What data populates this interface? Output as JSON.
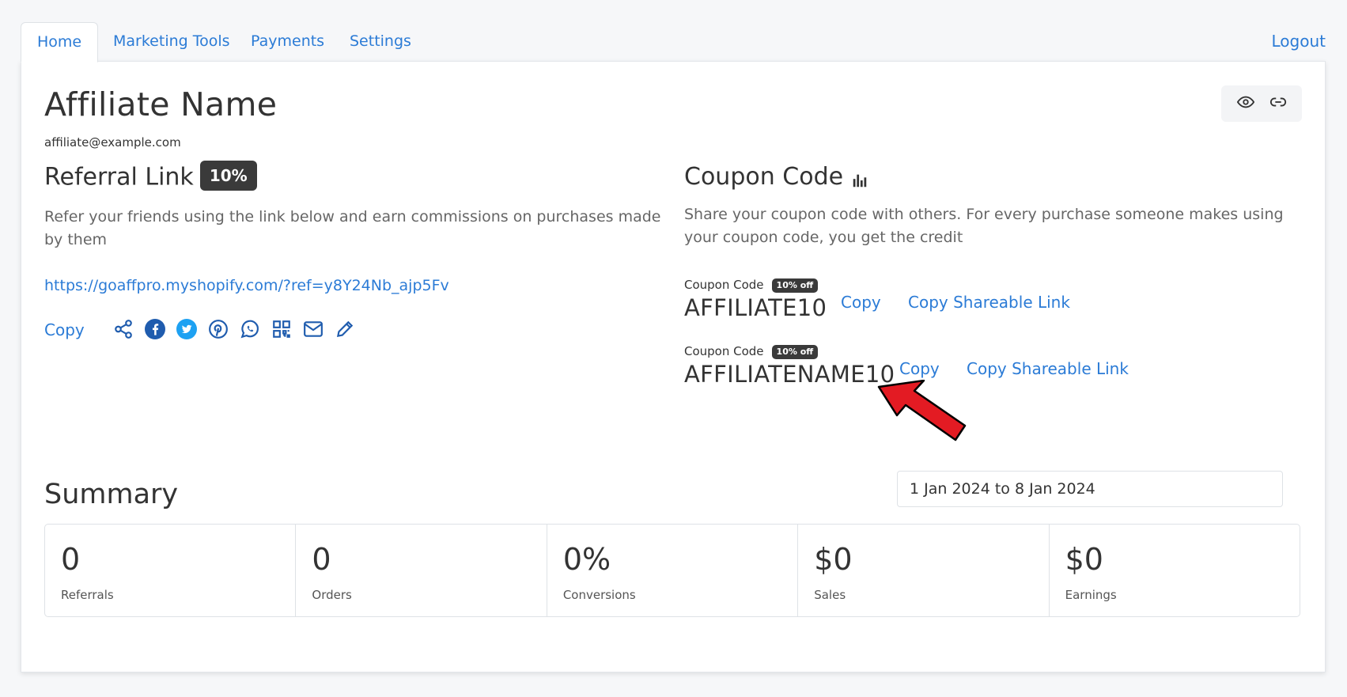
{
  "tabs": [
    {
      "label": "Home",
      "active": true
    },
    {
      "label": "Marketing Tools",
      "active": false
    },
    {
      "label": "Payments",
      "active": false
    },
    {
      "label": "Settings",
      "active": false
    }
  ],
  "logout_label": "Logout",
  "profile": {
    "name": "Affiliate Name",
    "email": "affiliate@example.com"
  },
  "header_icons": [
    "eye-icon",
    "link-icon"
  ],
  "referral": {
    "title": "Referral Link",
    "commission_badge": "10%",
    "description": "Refer your friends using the link below and earn commissions on purchases made by them",
    "url": "https://goaffpro.myshopify.com/?ref=y8Y24Nb_ajp5Fv",
    "copy_label": "Copy",
    "share_icons": [
      "share-icon",
      "facebook-icon",
      "twitter-icon",
      "pinterest-icon",
      "whatsapp-icon",
      "qr-code-icon",
      "email-icon",
      "edit-icon"
    ]
  },
  "coupon": {
    "title": "Coupon Code",
    "title_icon": "bar-chart-icon",
    "description": "Share your coupon code with others. For every purchase someone makes using your coupon code, you get the credit",
    "codes": [
      {
        "label": "Coupon Code",
        "badge": "10% off",
        "code": "AFFILIATE10",
        "copy_label": "Copy",
        "share_label": "Copy Shareable Link"
      },
      {
        "label": "Coupon Code",
        "badge": "10% off",
        "code": "AFFILIATENAME10",
        "copy_label": "Copy",
        "share_label": "Copy Shareable Link"
      }
    ]
  },
  "summary": {
    "title": "Summary",
    "date_range": "1 Jan 2024 to 8 Jan 2024",
    "stats": [
      {
        "value": "0",
        "label": "Referrals"
      },
      {
        "value": "0",
        "label": "Orders"
      },
      {
        "value": "0%",
        "label": "Conversions"
      },
      {
        "value": "$0",
        "label": "Sales"
      },
      {
        "value": "$0",
        "label": "Earnings"
      }
    ]
  },
  "colors": {
    "accent": "#2b7bd6",
    "badge": "#3a3a3a",
    "annotation_arrow": "#e31b23",
    "facebook": "#1f5cae",
    "twitter": "#1da1f2"
  }
}
